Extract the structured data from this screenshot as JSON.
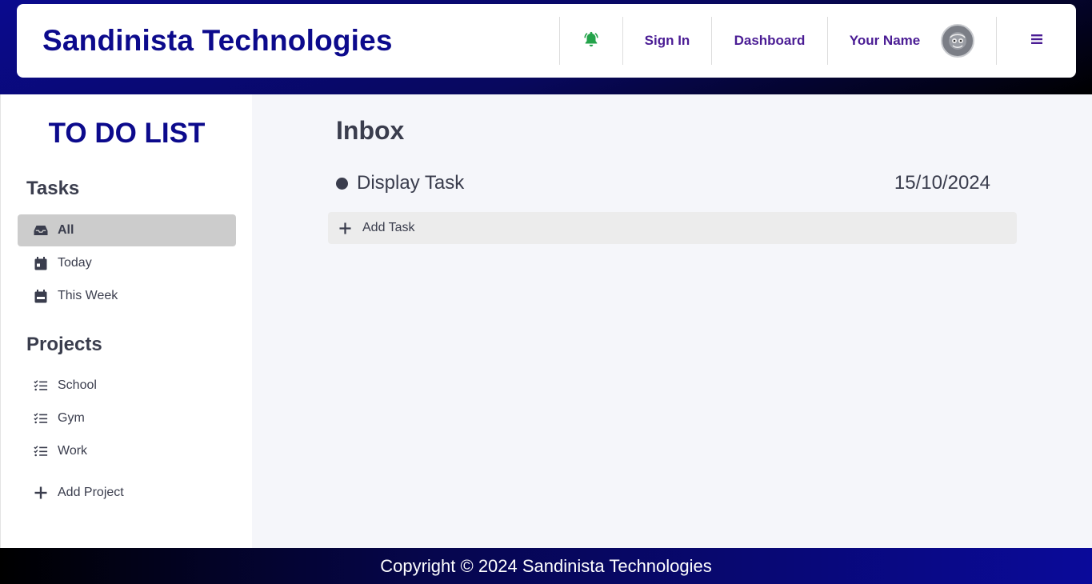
{
  "header": {
    "brand": "Sandinista Technologies",
    "sign_in": "Sign In",
    "dashboard": "Dashboard",
    "user_name": "Your Name",
    "bell_icon": "bell-icon",
    "menu_icon": "hamburger-menu-icon"
  },
  "sidebar": {
    "title": "TO DO LIST",
    "tasks_heading": "Tasks",
    "task_filters": [
      {
        "label": "All",
        "icon": "inbox-icon",
        "active": true
      },
      {
        "label": "Today",
        "icon": "calendar-day-icon",
        "active": false
      },
      {
        "label": "This Week",
        "icon": "calendar-week-icon",
        "active": false
      }
    ],
    "projects_heading": "Projects",
    "projects": [
      {
        "label": "School",
        "icon": "list-check-icon"
      },
      {
        "label": "Gym",
        "icon": "list-check-icon"
      },
      {
        "label": "Work",
        "icon": "list-check-icon"
      }
    ],
    "add_project": "Add Project"
  },
  "main": {
    "title": "Inbox",
    "tasks": [
      {
        "name": "Display Task",
        "date": "15/10/2024"
      }
    ],
    "add_task": "Add Task"
  },
  "footer": {
    "copyright": "Copyright © 2024 Sandinista Technologies"
  },
  "colors": {
    "brand": "#0c0a8c",
    "nav_text": "#4a1c94",
    "bell": "#23a34a",
    "text": "#3a3d4d"
  }
}
